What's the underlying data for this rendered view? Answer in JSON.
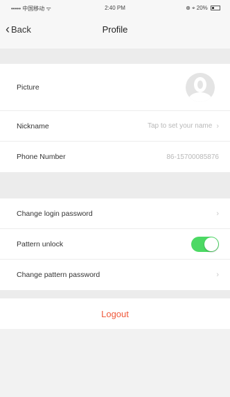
{
  "status_bar": {
    "carrier": "••••• 中国移动 ᯤ",
    "time": "2:40 PM",
    "right": "⊕ ⌖ 20%"
  },
  "nav": {
    "back_label": "Back",
    "title": "Profile"
  },
  "profile_rows": {
    "picture_label": "Picture",
    "nickname_label": "Nickname",
    "nickname_value": "Tap to set your name",
    "phone_label": "Phone Number",
    "phone_value": "86-15700085876"
  },
  "security_rows": {
    "change_login_label": "Change login password",
    "pattern_unlock_label": "Pattern unlock",
    "pattern_unlock_on": true,
    "change_pattern_label": "Change pattern password"
  },
  "logout_label": "Logout",
  "colors": {
    "toggle_on": "#4cd964",
    "logout": "#f05a3c"
  },
  "icons": {
    "back": "chevron-left-icon",
    "arrow": "chevron-right-icon",
    "avatar": "user-placeholder-icon"
  }
}
